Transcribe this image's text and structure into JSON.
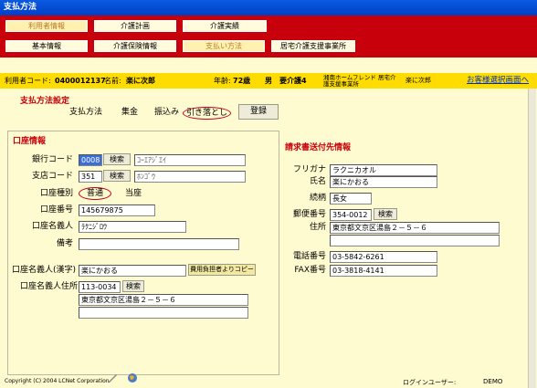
{
  "window": {
    "title": "支払方法"
  },
  "nav": {
    "row1": [
      "利用者情報",
      "介護計画",
      "介護実績"
    ],
    "row2": [
      "基本情報",
      "介護保険情報",
      "支払い方法",
      "居宅介護支援事業所"
    ]
  },
  "userbar": {
    "code_label": "利用者コード:",
    "code": "0400012137",
    "name_label": "名前:",
    "name": "楽に次郎",
    "age_label": "年齢:",
    "age": "72歳",
    "gender": "男",
    "care_level": "要介護4",
    "office": "湘南ホームフレンド 居宅介護支援事業所",
    "staff": "楽に次郎",
    "link": "お客様選択画面へ"
  },
  "payment": {
    "title": "支払方法設定",
    "label": "支払方法",
    "options": [
      "集金",
      "振込み",
      "引き落とし"
    ],
    "register": "登録"
  },
  "account": {
    "title": "口座情報",
    "bank_code_label": "銀行コード",
    "bank_code": "0008",
    "bank_name": "ｺｰｴｱｼﾞｴｲ",
    "branch_code_label": "支店コード",
    "branch_code": "351",
    "branch_name": "ﾎﾝｺﾞｳ",
    "search": "検索",
    "type_label": "口座種別",
    "type_options": [
      "普通",
      "当座"
    ],
    "number_label": "口座番号",
    "number": "145679875",
    "holder_label": "口座名義人",
    "holder": "ﾗｸﾆｼﾞﾛｳ",
    "remarks_label": "備考",
    "remarks": "",
    "holder_kanji_label": "口座名義人(漢字)",
    "holder_kanji": "楽にかおる",
    "copy_button": "費用負担者よりコピー",
    "holder_address_label": "口座名義人住所",
    "holder_zip": "113-0034",
    "holder_address1": "東京都文京区湯島２－５－６",
    "holder_address2": ""
  },
  "billing": {
    "title": "請求書送付先情報",
    "furigana_label": "フリガナ",
    "furigana": "ラクニカオル",
    "name_label": "氏名",
    "name": "楽にかおる",
    "relation_label": "続柄",
    "relation": "長女",
    "zip_label": "郵便番号",
    "zip": "354-0012",
    "search": "検索",
    "address_label": "住所",
    "address": "東京都文京区湯島２－５－６",
    "address2": "",
    "tel_label": "電話番号",
    "tel": "03-5842-6261",
    "fax_label": "FAX番号",
    "fax": "03-3818-4141"
  },
  "footer": {
    "copyright": "Copyright (C) 2004 LCNet Corporation",
    "login_label": "ログインユーザー:",
    "login_user": "DEMO"
  },
  "colors": {
    "menubar": "#c8000c",
    "userbar": "#ffdc00",
    "background": "#fffbd0",
    "section_title": "#c8000c"
  }
}
